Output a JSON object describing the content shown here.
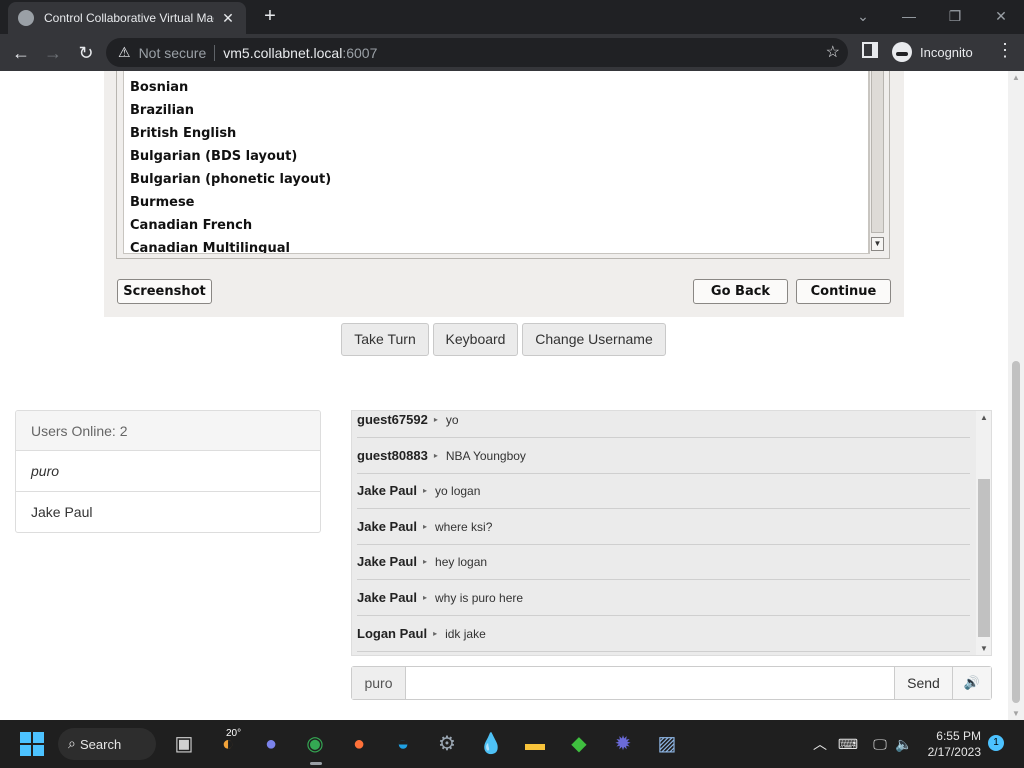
{
  "browser": {
    "tab_title": "Control Collaborative Virtual Machine",
    "new_tab_icon": "plus-icon",
    "address": {
      "security_label": "Not secure",
      "host": "vm5.collabnet.local",
      "port": ":6007"
    },
    "incognito_label": "Incognito"
  },
  "vm": {
    "keyboard_layouts": [
      "Bosnian",
      "Brazilian",
      "British English",
      "Bulgarian (BDS layout)",
      "Bulgarian (phonetic layout)",
      "Burmese",
      "Canadian French",
      "Canadian Multilingual"
    ],
    "buttons": {
      "screenshot": "Screenshot",
      "go_back": "Go Back",
      "continue": "Continue"
    }
  },
  "controls": {
    "take_turn": "Take Turn",
    "keyboard": "Keyboard",
    "change_username": "Change Username"
  },
  "users": {
    "header": "Users Online: 2",
    "list": [
      "puro",
      "Jake Paul"
    ]
  },
  "chat": {
    "messages": [
      {
        "user": "guest67592",
        "text": "yo"
      },
      {
        "user": "guest80883",
        "text": "NBA Youngboy"
      },
      {
        "user": "Jake Paul",
        "text": "yo logan"
      },
      {
        "user": "Jake Paul",
        "text": "where ksi?"
      },
      {
        "user": "Jake Paul",
        "text": "hey logan"
      },
      {
        "user": "Jake Paul",
        "text": "why is puro here"
      },
      {
        "user": "Logan Paul",
        "text": "idk jake"
      }
    ],
    "username_addon": "puro",
    "input_value": "",
    "send_label": "Send"
  },
  "taskbar": {
    "search_label": "Search",
    "weather_temp": "20°",
    "time": "6:55 PM",
    "date": "2/17/2023",
    "notification_count": "1"
  }
}
